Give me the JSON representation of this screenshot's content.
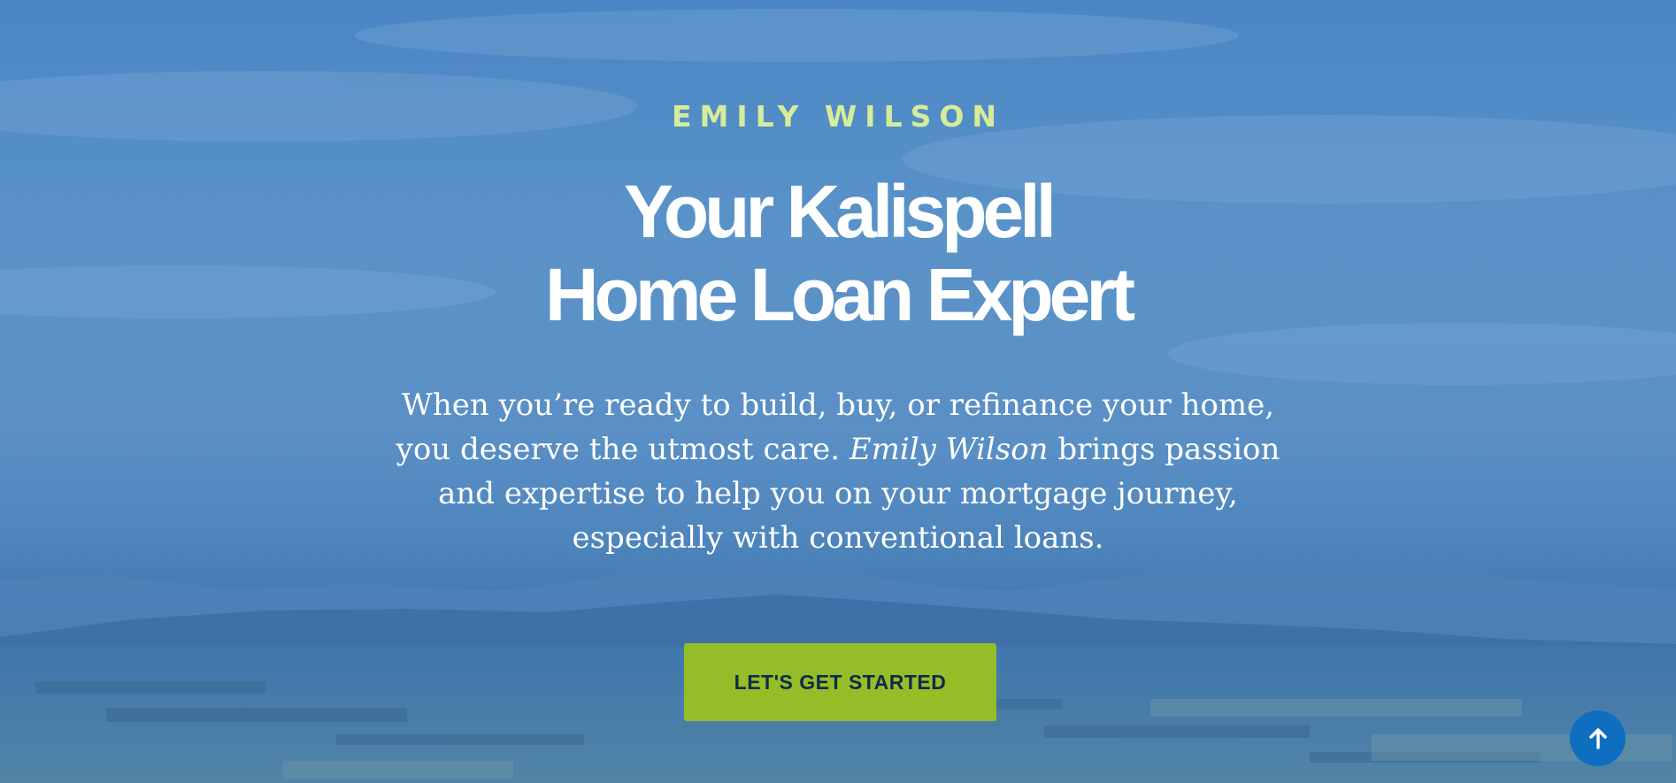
{
  "hero": {
    "eyebrow": "EMILY WILSON",
    "headline_line1": "Your Kalispell",
    "headline_line2": "Home Loan Expert",
    "description_part1": "When you’re ready to build, buy, or refinance your home, you deserve the utmost care. ",
    "description_emphasis": "Emily Wilson",
    "description_part2": " brings passion and expertise to help you on your mortgage journey, especially with conventional loans.",
    "cta_label": "LET'S GET STARTED"
  },
  "back_to_top": {
    "icon": "arrow-up-icon"
  },
  "colors": {
    "overlay_blue": "#4a86c4",
    "eyebrow": "#d6ec9a",
    "cta_background": "#95bd28",
    "cta_text": "#0f2a4a",
    "back_to_top": "#0e6fc1"
  }
}
